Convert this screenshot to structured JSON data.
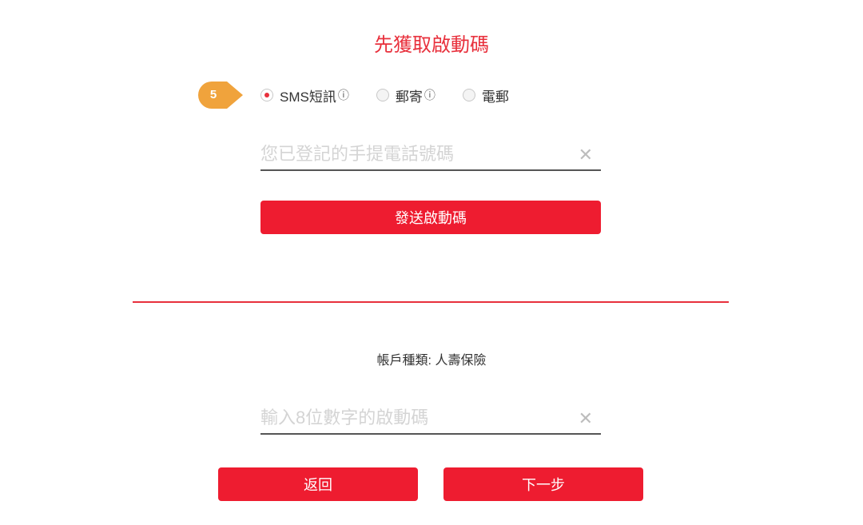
{
  "page": {
    "title": "先獲取啟動碼",
    "step_number": "5"
  },
  "delivery_options": [
    {
      "label": "SMS短訊",
      "info": "ⓘ",
      "checked": true
    },
    {
      "label": "郵寄",
      "info": "ⓘ",
      "checked": false
    },
    {
      "label": "電郵",
      "info": "",
      "checked": false
    }
  ],
  "phone_input": {
    "value": "",
    "placeholder": "您已登記的手提電話號碼",
    "clear_symbol": "✕"
  },
  "send_button": {
    "label": "發送啟動碼"
  },
  "account": {
    "type_text": "帳戶種類: 人壽保險"
  },
  "code_input": {
    "value": "",
    "placeholder": "輸入8位數字的啟動碼",
    "clear_symbol": "✕"
  },
  "footer": {
    "back_label": "返回",
    "next_label": "下一步"
  },
  "colors": {
    "accent_red": "#ee1c30",
    "title_red": "#e8303c",
    "badge_orange": "#f0a33c"
  },
  "icons": {
    "step_badge": "step-pointer-badge",
    "clear": "close-icon",
    "info": "info-icon"
  }
}
